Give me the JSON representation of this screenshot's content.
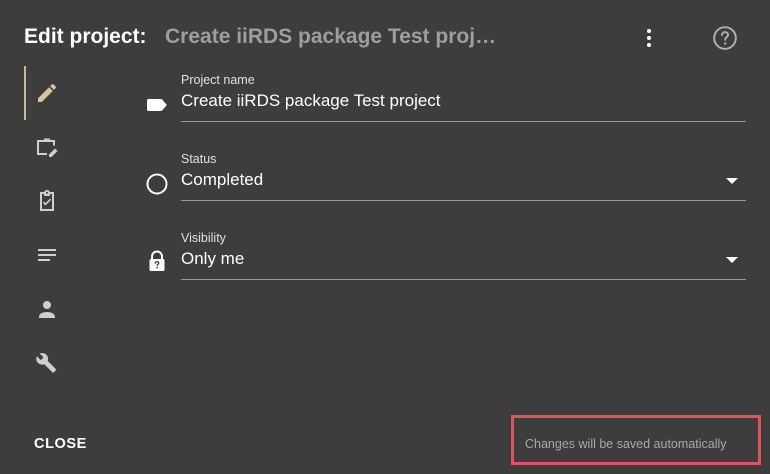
{
  "header": {
    "title_label": "Edit project:",
    "project_name": "Create iiRDS package Test project"
  },
  "icons": {
    "more": "more-vert-icon",
    "help": "help-circle-icon"
  },
  "sidenav": {
    "items": [
      {
        "icon": "pencil-icon",
        "active": true
      },
      {
        "icon": "briefcase-edit-icon",
        "active": false
      },
      {
        "icon": "clipboard-check-icon",
        "active": false
      },
      {
        "icon": "text-lines-icon",
        "active": false
      },
      {
        "icon": "person-icon",
        "active": false
      },
      {
        "icon": "tools-icon",
        "active": false
      }
    ]
  },
  "fields": {
    "project_name": {
      "label": "Project name",
      "value": "Create iiRDS package Test project",
      "icon": "label-tag-icon"
    },
    "status": {
      "label": "Status",
      "value": "Completed",
      "icon": "circle-outline-icon"
    },
    "visibility": {
      "label": "Visibility",
      "value": "Only me",
      "icon": "lock-question-icon"
    }
  },
  "footer": {
    "close_label": "CLOSE",
    "autosave_text": "Changes will be saved automatically"
  },
  "colors": {
    "background": "#3d3d3d",
    "active_indicator": "#c8b98a",
    "highlight_border": "#e0525c"
  }
}
